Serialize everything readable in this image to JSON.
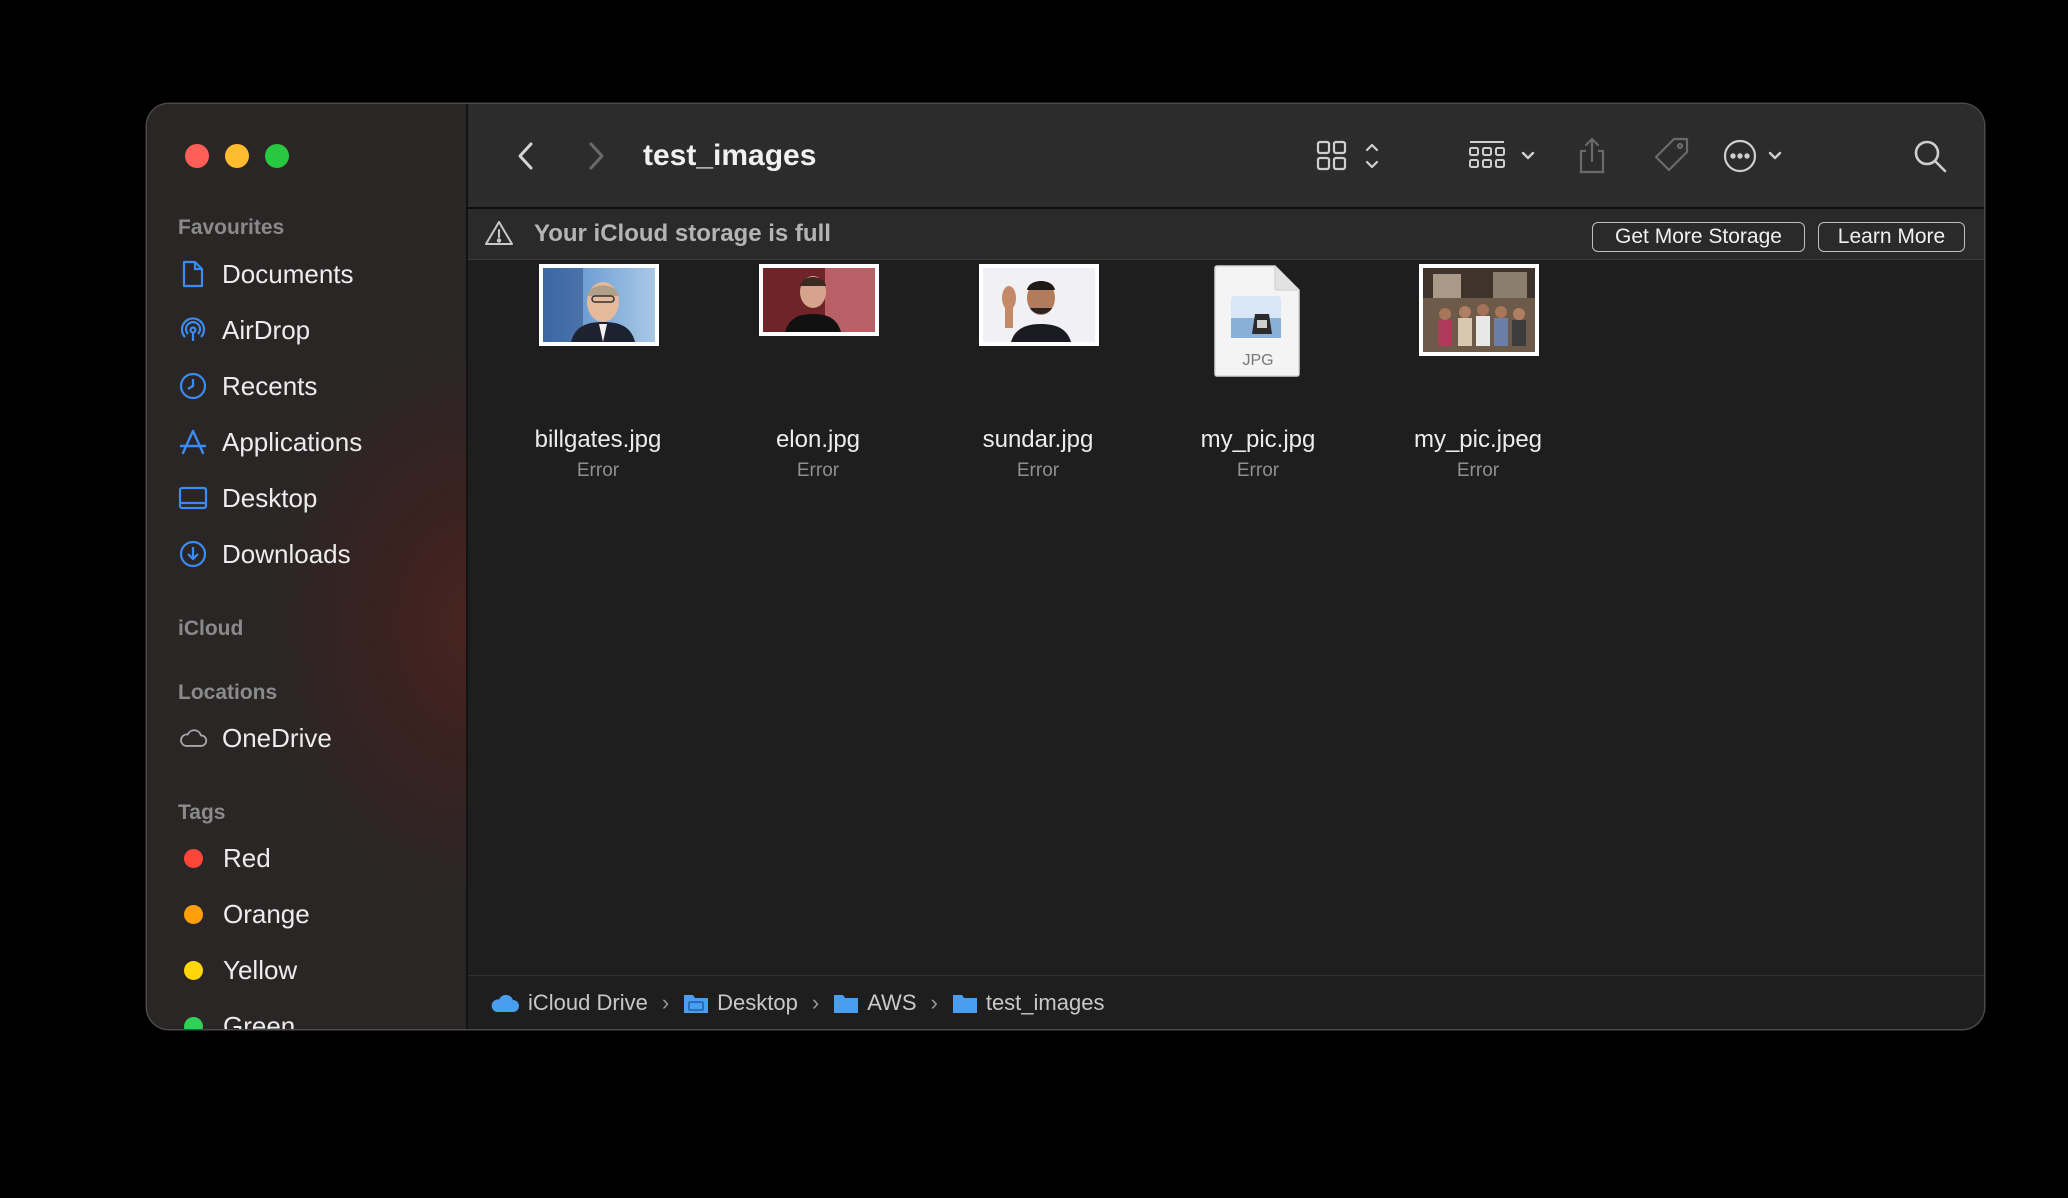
{
  "window": {
    "title": "test_images"
  },
  "sidebar": {
    "sections": {
      "favourites": "Favourites",
      "icloud": "iCloud",
      "locations": "Locations",
      "tags": "Tags"
    },
    "favourites": [
      {
        "label": "Documents",
        "icon": "document-icon"
      },
      {
        "label": "AirDrop",
        "icon": "airdrop-icon"
      },
      {
        "label": "Recents",
        "icon": "clock-icon"
      },
      {
        "label": "Applications",
        "icon": "applications-icon"
      },
      {
        "label": "Desktop",
        "icon": "desktop-icon"
      },
      {
        "label": "Downloads",
        "icon": "download-icon"
      }
    ],
    "locations": [
      {
        "label": "OneDrive",
        "icon": "cloud-icon"
      }
    ],
    "tags": [
      {
        "label": "Red",
        "color": "#ff453a"
      },
      {
        "label": "Orange",
        "color": "#ff9f0a"
      },
      {
        "label": "Yellow",
        "color": "#ffd60a"
      },
      {
        "label": "Green",
        "color": "#30d158"
      }
    ]
  },
  "banner": {
    "message": "Your iCloud storage is full",
    "get_more": "Get More Storage",
    "learn_more": "Learn More"
  },
  "files": [
    {
      "name": "billgates.jpg",
      "status": "Error"
    },
    {
      "name": "elon.jpg",
      "status": "Error"
    },
    {
      "name": "sundar.jpg",
      "status": "Error"
    },
    {
      "name": "my_pic.jpg",
      "status": "Error",
      "type_label": "JPG"
    },
    {
      "name": "my_pic.jpeg",
      "status": "Error"
    }
  ],
  "pathbar": [
    {
      "label": "iCloud Drive",
      "icon": "icloud-icon"
    },
    {
      "label": "Desktop",
      "icon": "desktop-folder-icon"
    },
    {
      "label": "AWS",
      "icon": "folder-icon"
    },
    {
      "label": "test_images",
      "icon": "folder-icon"
    }
  ],
  "colors": {
    "accent": "#3b8bf5",
    "window_bg": "#1e1e1e",
    "sidebar_bg": "#2b2626"
  }
}
